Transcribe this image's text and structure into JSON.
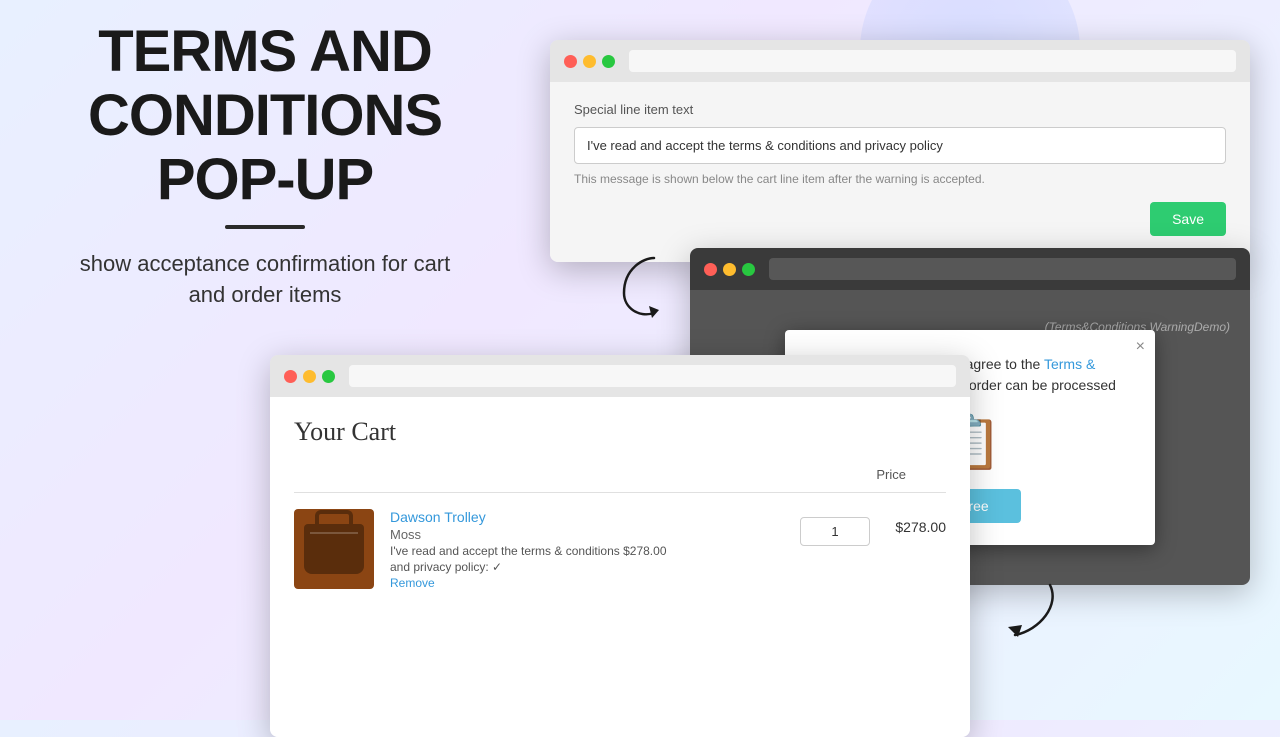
{
  "title": {
    "line1": "TERMS AND",
    "line2": "CONDITIONS",
    "line3": "POP-UP"
  },
  "subtitle": "show acceptance confirmation for cart and order items",
  "settings_panel": {
    "label": "Special line item text",
    "input_value": "I've read and accept the terms & conditions and privacy policy",
    "hint": "This message is shown below the cart line item after the warning is accepted.",
    "save_button": "Save"
  },
  "modal": {
    "bg_label": "(Terms&Conditions WarningDemo)",
    "popup_text_prefix": "You must read and agree to the",
    "popup_link": "Terms & Conditions",
    "popup_text_suffix": "before your order can be processed",
    "agree_button": "Agree",
    "close_x": "×"
  },
  "cart": {
    "title": "Your Cart",
    "price_col_header": "Price",
    "item": {
      "name": "Dawson Trolley",
      "variant": "Moss",
      "terms_text": "I've read and accept the terms & conditions",
      "price_inline": "$278.00",
      "privacy_text": "and privacy policy: ✓",
      "remove": "Remove",
      "quantity": "1",
      "price": "$278.00"
    }
  },
  "icons": {
    "dot_red": "●",
    "dot_yellow": "●",
    "dot_green": "●"
  }
}
